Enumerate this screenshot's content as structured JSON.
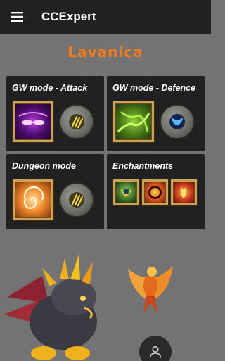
{
  "app_bar": {
    "title": "CCExpert",
    "menu_icon": "hamburger-menu-icon"
  },
  "hero": {
    "name": "Lavanica"
  },
  "cards": {
    "gw_attack": {
      "title": "GW mode - Attack",
      "skill_icon": "purple-glowing-eyes-skill-icon",
      "rune_icon": "yellow-claw-rune-icon"
    },
    "gw_defence": {
      "title": "GW mode - Defence",
      "skill_icon": "green-vines-skill-icon",
      "rune_icon": "blue-wings-rune-icon"
    },
    "dungeon": {
      "title": "Dungeon mode",
      "skill_icon": "orange-swirl-skill-icon",
      "rune_icon": "yellow-claw-rune-icon"
    },
    "enchantments": {
      "title": "Enchantments",
      "items": [
        "green-hero-enchant-icon",
        "fire-ring-enchant-icon",
        "phoenix-enchant-icon"
      ]
    }
  },
  "bottom": {
    "art_left": "dragon-illustration",
    "art_right": "phoenix-illustration",
    "profile_icon": "user-profile-icon"
  },
  "colors": {
    "app_bar": "#212121",
    "background": "#737373",
    "card": "#212121",
    "hero_name": "#ff7a1a",
    "frame": "#c9a25a"
  }
}
